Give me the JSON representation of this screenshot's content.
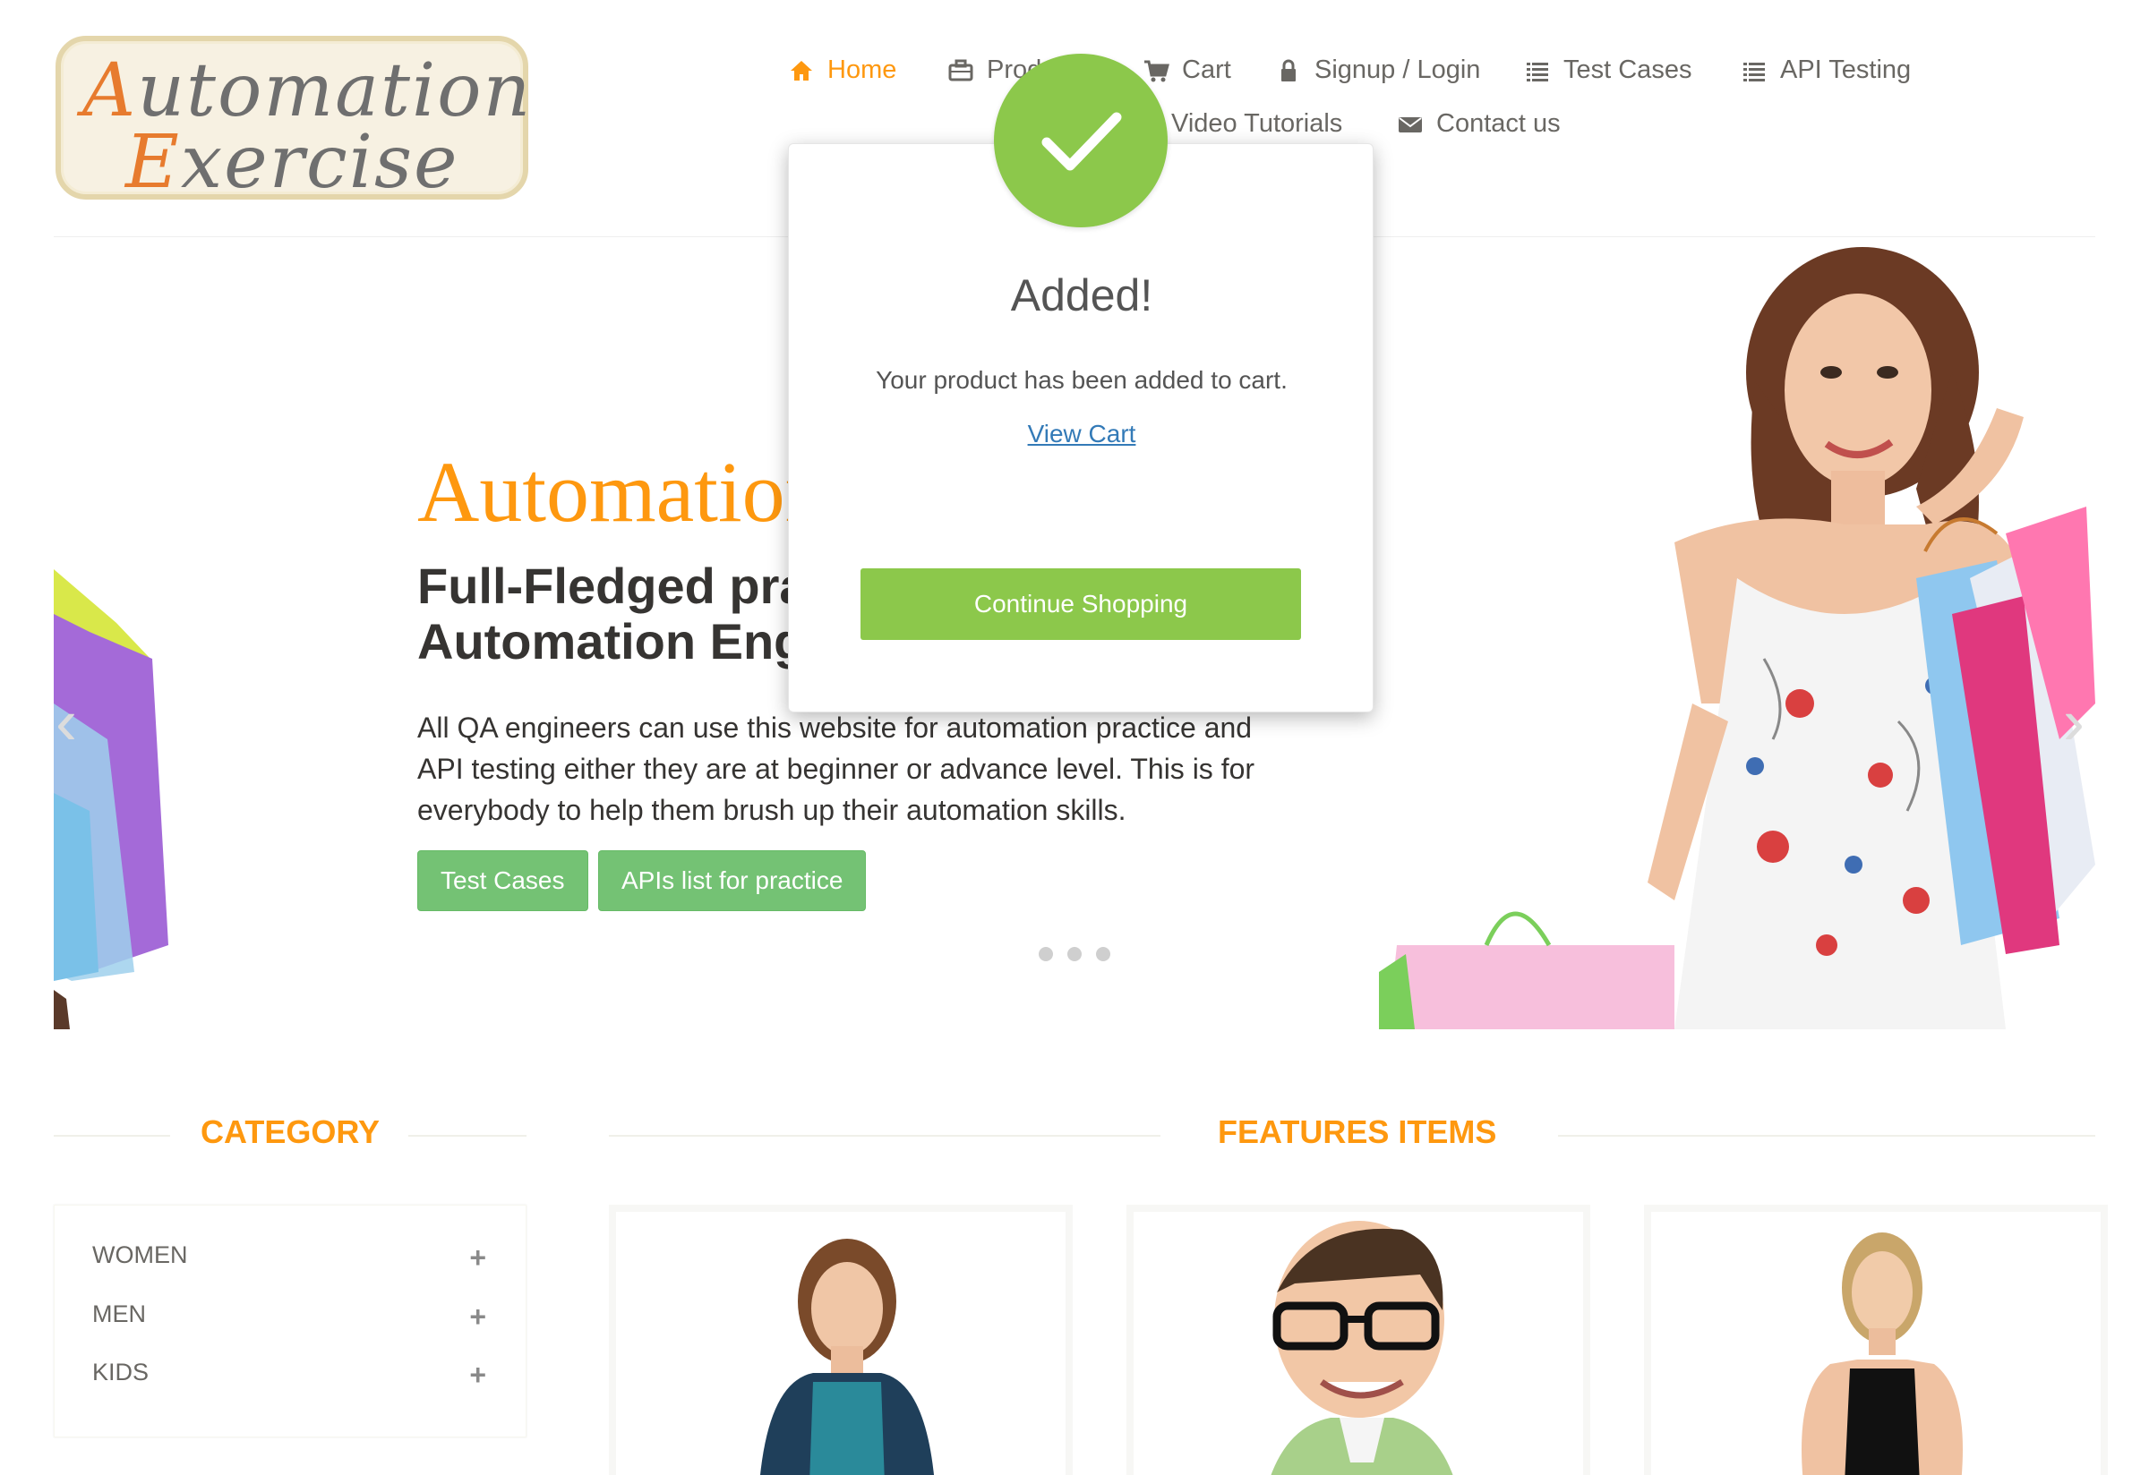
{
  "header": {
    "logo_word1": "Automation",
    "logo_word2": "Exercise",
    "nav": [
      {
        "label": "Home",
        "icon": "home-icon"
      },
      {
        "label": "Products",
        "icon": "briefcase-icon"
      },
      {
        "label": "Cart",
        "icon": "cart-icon"
      },
      {
        "label": "Signup / Login",
        "icon": "lock-icon"
      },
      {
        "label": "Test Cases",
        "icon": "list-icon"
      },
      {
        "label": "API Testing",
        "icon": "list-icon"
      },
      {
        "label": "Video Tutorials",
        "icon": "youtube-icon"
      },
      {
        "label": "Contact us",
        "icon": "envelope-icon"
      }
    ]
  },
  "slider": {
    "brand": "AutomationExercise",
    "title": "Full-Fledged practice website for Automation Engineers",
    "text": "All QA engineers can use this website for automation practice and API testing either they are at beginner or advance level. This is for everybody to help them brush up their automation skills.",
    "buttons": [
      "Test Cases",
      "APIs list for practice"
    ],
    "dots": 3
  },
  "sidebar": {
    "heading": "CATEGORY",
    "categories": [
      "WOMEN",
      "MEN",
      "KIDS"
    ]
  },
  "features": {
    "heading": "FEATURES ITEMS"
  },
  "modal": {
    "title": "Added!",
    "message": "Your product has been added to cart.",
    "link": "View Cart",
    "button": "Continue Shopping"
  },
  "colors": {
    "accent": "#fe980f",
    "success": "#8cc84b",
    "button_green": "#5cb85c",
    "link": "#337ab7"
  }
}
